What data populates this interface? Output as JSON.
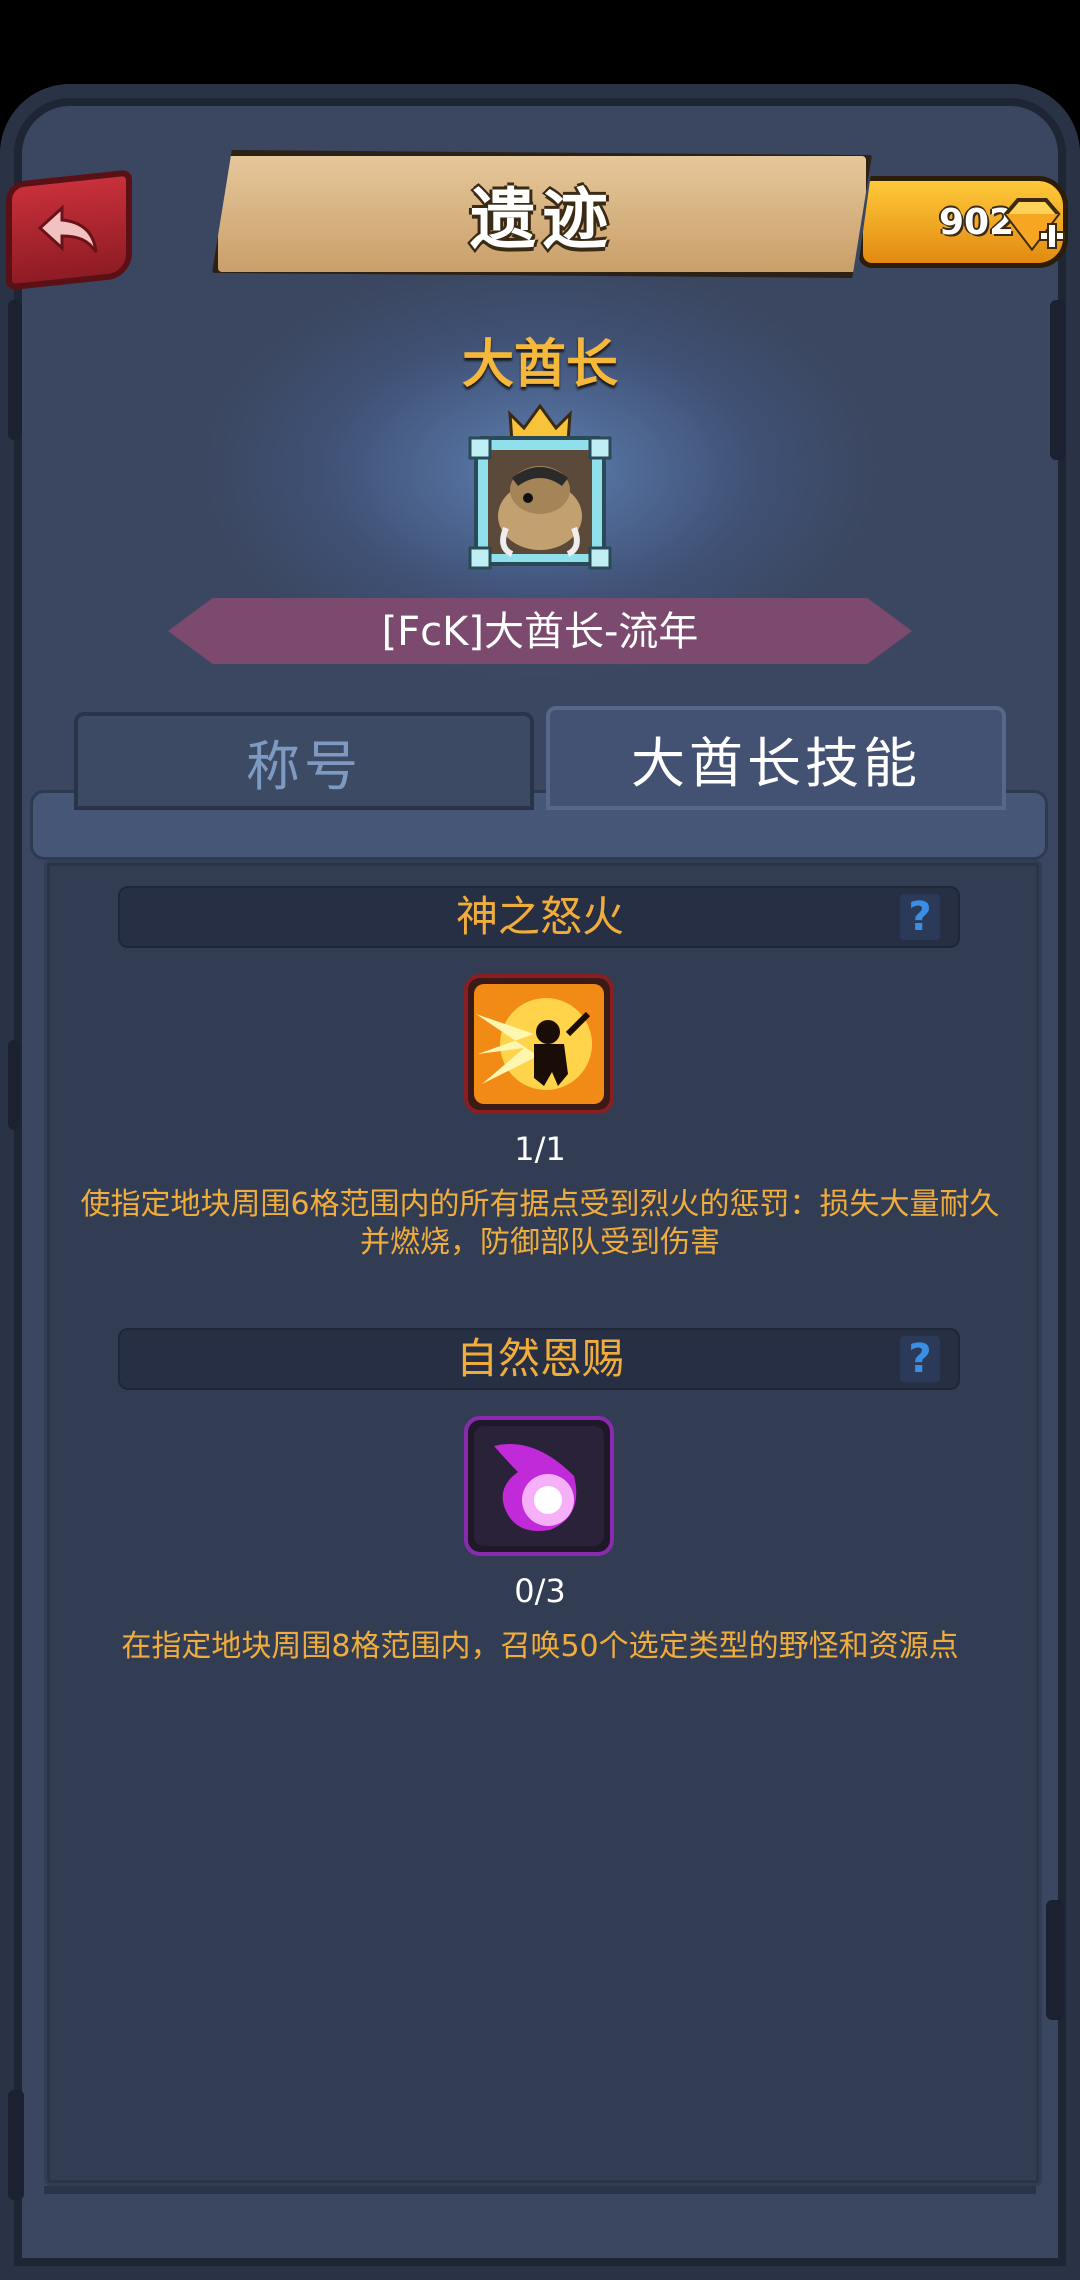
{
  "header": {
    "title": "遗迹",
    "gems": "902"
  },
  "profile": {
    "rank_title": "大酋长",
    "player_name": "[FcK]大酋长-流年"
  },
  "tabs": [
    {
      "label": "称号",
      "active": false
    },
    {
      "label": "大酋长技能",
      "active": true
    }
  ],
  "skills": [
    {
      "name": "神之怒火",
      "help": "?",
      "icon": "flame-warrior-icon",
      "count": "1/1",
      "description": "使指定地块周围6格范围内的所有据点受到烈火的惩罚：损失大量耐久并燃烧，防御部队受到伤害"
    },
    {
      "name": "自然恩赐",
      "help": "?",
      "icon": "purple-fireball-icon",
      "count": "0/3",
      "description": "在指定地块周围8格范围内，召唤50个选定类型的野怪和资源点"
    }
  ],
  "colors": {
    "panel": "#3b4760",
    "accent_gold": "#f1ad3c",
    "ribbon": "#7b4a6e",
    "help_blue": "#3a8ee6"
  }
}
